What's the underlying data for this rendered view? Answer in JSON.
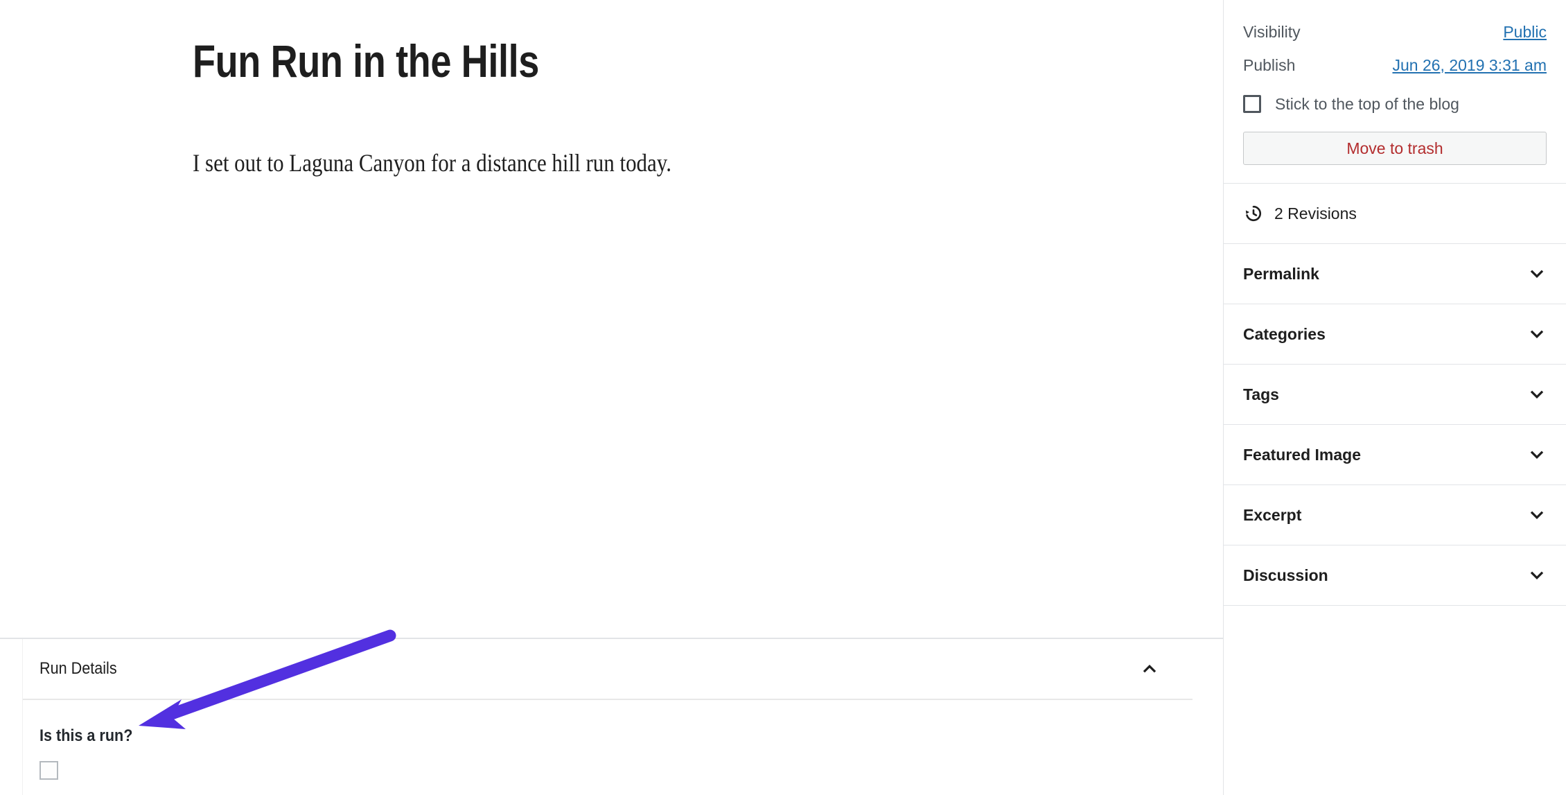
{
  "editor": {
    "post_title": "Fun Run in the Hills",
    "post_paragraph": "I set out to Laguna Canyon for a distance hill run today."
  },
  "metabox": {
    "title": "Run Details",
    "toggle_icon": "chevron-up-icon",
    "field_label": "Is this a run?",
    "field_checked": false
  },
  "sidebar": {
    "status": {
      "visibility_label": "Visibility",
      "visibility_value": "Public",
      "publish_label": "Publish",
      "publish_value": "Jun 26, 2019 3:31 am",
      "sticky_label": "Stick to the top of the blog",
      "sticky_checked": false,
      "trash_label": "Move to trash"
    },
    "revisions": {
      "icon": "revisions-clock-icon",
      "label": "2 Revisions"
    },
    "panels": [
      {
        "label": "Permalink",
        "icon": "chevron-down-icon"
      },
      {
        "label": "Categories",
        "icon": "chevron-down-icon"
      },
      {
        "label": "Tags",
        "icon": "chevron-down-icon"
      },
      {
        "label": "Featured Image",
        "icon": "chevron-down-icon"
      },
      {
        "label": "Excerpt",
        "icon": "chevron-down-icon"
      },
      {
        "label": "Discussion",
        "icon": "chevron-down-icon"
      }
    ]
  },
  "annotation": {
    "type": "arrow",
    "color": "#5230e0",
    "points_to": "Is this a run?"
  },
  "colors": {
    "link": "#2271b1",
    "danger": "#b32d2e",
    "text": "#1e1e1e",
    "muted": "#50575e",
    "border": "#e2e4e7",
    "annotation": "#5230e0"
  }
}
